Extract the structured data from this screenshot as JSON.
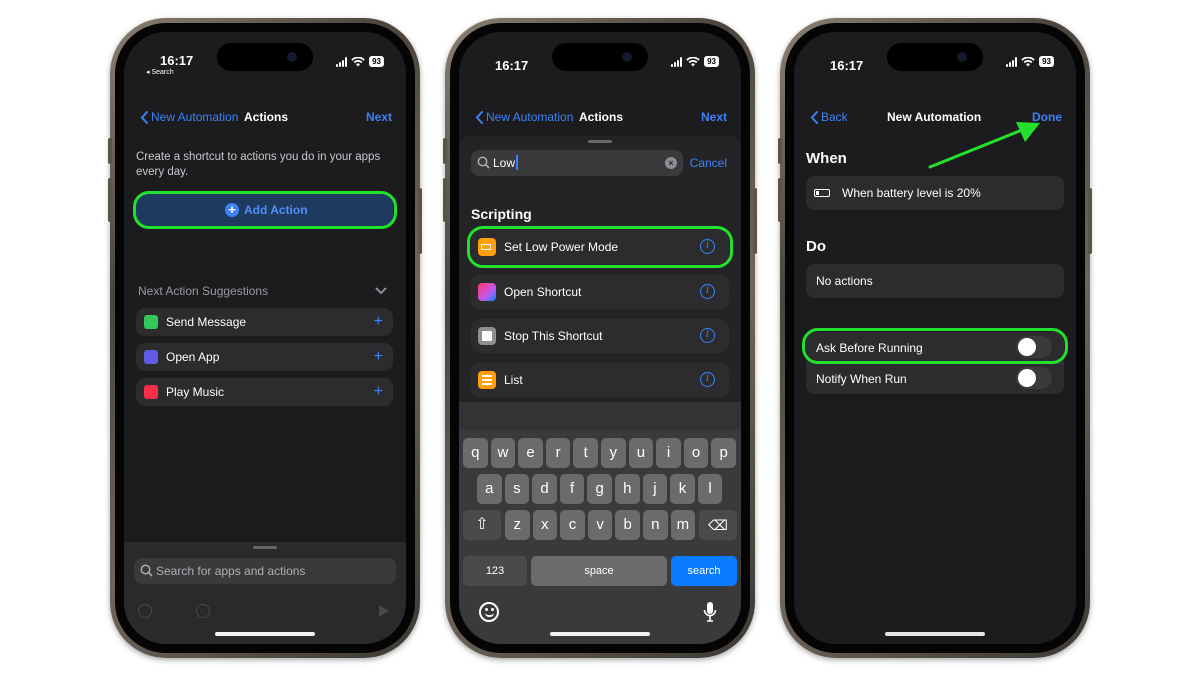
{
  "status": {
    "time": "16:17",
    "back_to": "◂ Search",
    "battery": "93"
  },
  "phone1": {
    "nav": {
      "back": "New Automation",
      "title": "Actions",
      "next": "Next"
    },
    "intro": "Create a shortcut to actions you do in your apps every day.",
    "add_action": "Add Action",
    "suggestions_header": "Next Action Suggestions",
    "suggestions": [
      {
        "label": "Send Message",
        "icon": "message-icon",
        "color": "#34c759"
      },
      {
        "label": "Open App",
        "icon": "open-app-icon",
        "color": "#5e5ce6"
      },
      {
        "label": "Play Music",
        "icon": "music-icon",
        "color": "#fa2d48"
      }
    ],
    "search_placeholder": "Search for apps and actions"
  },
  "phone2": {
    "nav": {
      "back": "New Automation",
      "title": "Actions",
      "next": "Next"
    },
    "search_value": "Low",
    "cancel": "Cancel",
    "section": "Scripting",
    "results": [
      {
        "label": "Set Low Power Mode",
        "icon": "battery-icon",
        "color": "#ff9f0a"
      },
      {
        "label": "Open Shortcut",
        "icon": "shortcuts-icon",
        "color": "#ff375f"
      },
      {
        "label": "Stop This Shortcut",
        "icon": "stop-icon",
        "color": "#8e8e93"
      },
      {
        "label": "List",
        "icon": "list-icon",
        "color": "#ff9f0a"
      }
    ],
    "keyboard": {
      "row1": [
        "q",
        "w",
        "e",
        "r",
        "t",
        "y",
        "u",
        "i",
        "o",
        "p"
      ],
      "row2": [
        "a",
        "s",
        "d",
        "f",
        "g",
        "h",
        "j",
        "k",
        "l"
      ],
      "row3": [
        "z",
        "x",
        "c",
        "v",
        "b",
        "n",
        "m"
      ],
      "numbers": "123",
      "space": "space",
      "search": "search"
    }
  },
  "phone3": {
    "nav": {
      "back": "Back",
      "title": "New Automation",
      "done": "Done"
    },
    "when_header": "When",
    "when_value": "When battery level is 20%",
    "do_header": "Do",
    "do_value": "No actions",
    "toggles": [
      {
        "label": "Ask Before Running",
        "on": false
      },
      {
        "label": "Notify When Run",
        "on": false
      }
    ]
  },
  "colors": {
    "accent": "#3b82f6",
    "highlight": "#22e02b"
  }
}
